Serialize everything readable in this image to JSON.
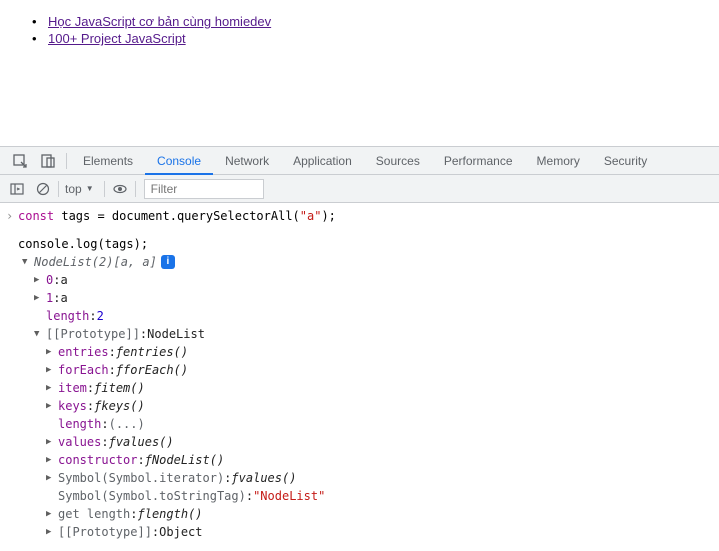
{
  "page": {
    "links": [
      "Học JavaScript cơ bản cùng homiedev",
      "100+ Project JavaScript"
    ]
  },
  "devtools": {
    "tabs": [
      "Elements",
      "Console",
      "Network",
      "Application",
      "Sources",
      "Performance",
      "Memory",
      "Security"
    ],
    "active_tab": "Console",
    "context": "top",
    "filter_placeholder": "Filter"
  },
  "console": {
    "input_line": {
      "kw": "const",
      "rest1": " tags = document.querySelectorAll(",
      "str": "\"a\"",
      "rest2": ");"
    },
    "log_line": "console.log(tags);",
    "nodelist_label": "NodeList(2)",
    "nodelist_preview": " [a, a]",
    "items": [
      {
        "key": "0",
        "val": "a"
      },
      {
        "key": "1",
        "val": "a"
      }
    ],
    "length_key": "length",
    "length_val": "2",
    "proto_label": "[[Prototype]]",
    "proto_type": "NodeList",
    "proto_methods": [
      {
        "key": "entries",
        "fn": "entries()"
      },
      {
        "key": "forEach",
        "fn": "forEach()"
      },
      {
        "key": "item",
        "fn": "item()"
      },
      {
        "key": "keys",
        "fn": "keys()"
      }
    ],
    "proto_length_key": "length",
    "proto_length_val": "(...)",
    "proto_methods2": [
      {
        "key": "values",
        "fn": "values()"
      },
      {
        "key": "constructor",
        "fn": "NodeList()"
      }
    ],
    "symbol_iter_key": "Symbol(Symbol.iterator)",
    "symbol_iter_fn": "values()",
    "symbol_tag_key": "Symbol(Symbol.toStringTag)",
    "symbol_tag_val": "\"NodeList\"",
    "get_length_key": "get length",
    "get_length_fn": "length()",
    "proto2_label": "[[Prototype]]",
    "proto2_type": "Object"
  }
}
